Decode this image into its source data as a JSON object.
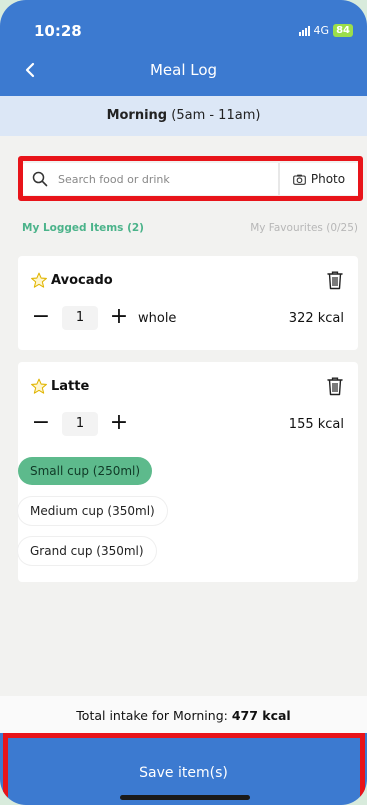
{
  "status": {
    "time": "10:28",
    "network": "4G",
    "battery": "84"
  },
  "header": {
    "back_icon": "chevron-left-icon",
    "title": "Meal Log"
  },
  "period": {
    "name": "Morning",
    "range": " (5am - 11am)"
  },
  "search": {
    "placeholder": "Search food or drink",
    "photo_label": "Photo"
  },
  "tabs": [
    {
      "label": "My Logged Items (2)"
    },
    {
      "label": "My Favourites (0/25)"
    }
  ],
  "items": [
    {
      "name": "Avocado",
      "quantity": "1",
      "unit": "whole",
      "kcal": "322 kcal"
    },
    {
      "name": "Latte",
      "quantity": "1",
      "unit": "",
      "kcal": "155 kcal",
      "options": [
        "Small cup (250ml)",
        "Medium cup (350ml)",
        "Grand cup (350ml)"
      ],
      "selected_option": "Small cup (250ml)"
    }
  ],
  "total": {
    "prefix": "Total intake for Morning: ",
    "value": "477 kcal"
  },
  "save_label": "Save item(s)",
  "colors": {
    "primary": "#3c7ad0",
    "accent": "#5dba8c",
    "highlight": "#e8141a"
  }
}
